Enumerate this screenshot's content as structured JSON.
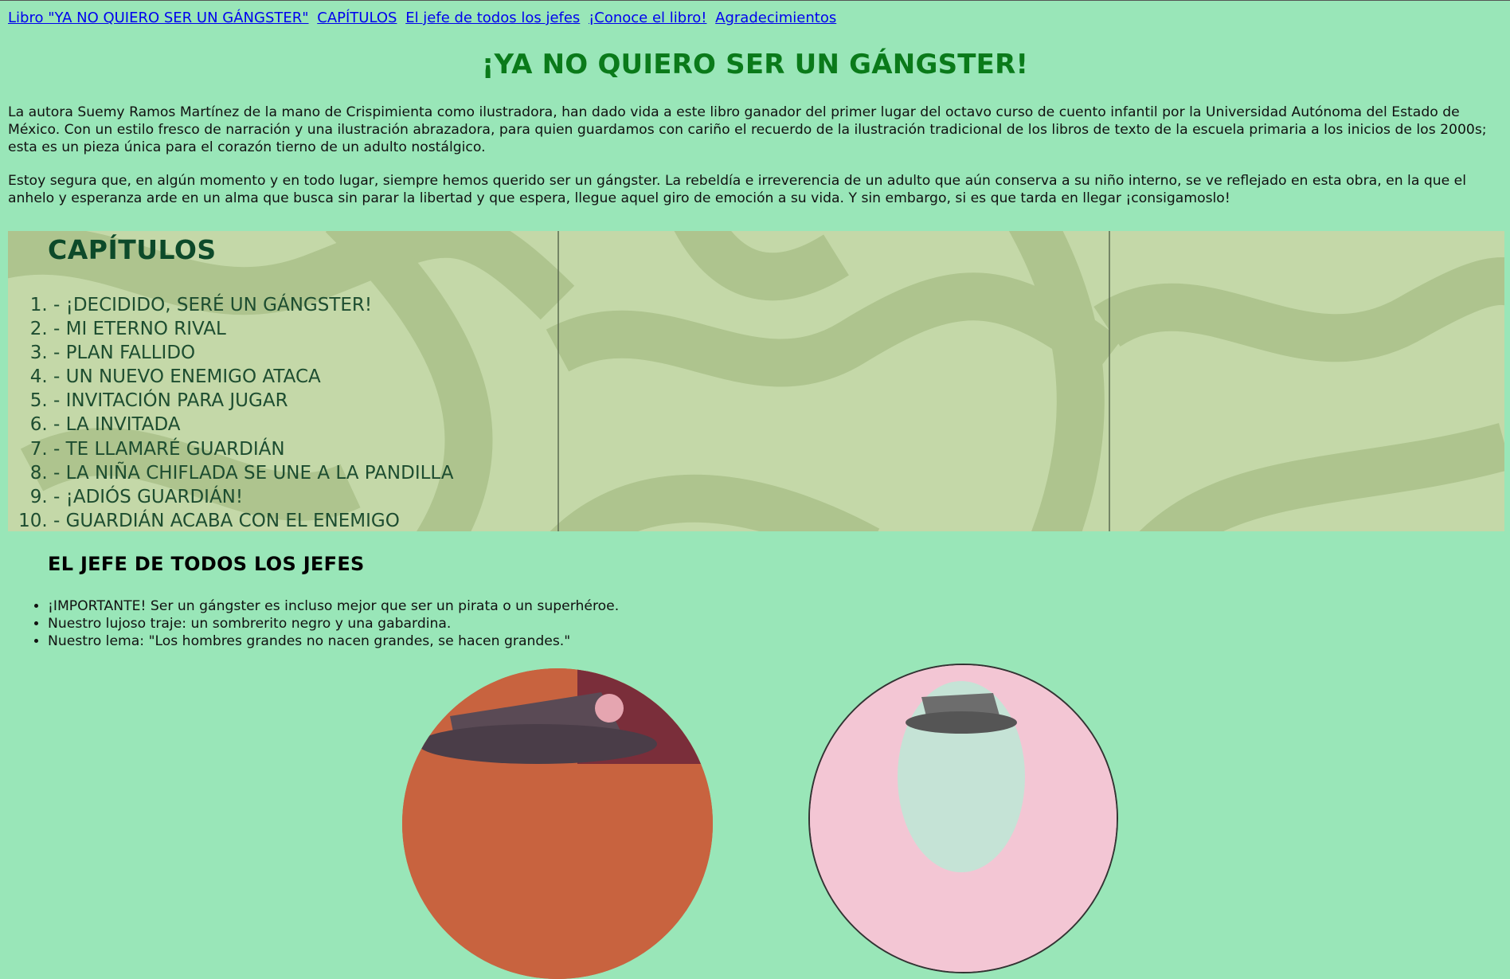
{
  "nav": {
    "links": [
      "Libro \"YA NO QUIERO SER UN GÁNGSTER\"",
      "CAPÍTULOS",
      "El jefe de todos los jefes",
      "¡Conoce el libro!",
      "Agradecimientos"
    ]
  },
  "header": {
    "title": "¡YA NO QUIERO SER UN GÁNGSTER!"
  },
  "intro": {
    "paragraph1": "La autora Suemy Ramos Martínez de la mano de Crispimienta como ilustradora, han dado vida a este libro ganador del primer lugar del octavo curso de cuento infantil por la Universidad Autónoma del Estado de México. Con un estilo fresco de narración y una ilustración abrazadora, para quien guardamos con cariño el recuerdo de la ilustración tradicional de los libros de texto de la escuela primaria a los inicios de los 2000s; esta es un pieza única para el corazón tierno de un adulto nostálgico.",
    "paragraph2": "Estoy segura que, en algún momento y en todo lugar, siempre hemos querido ser un gángster. La rebeldía e irreverencia de un adulto que aún conserva a su niño interno, se ve reflejado en esta obra, en la que el anhelo y esperanza arde en un alma que busca sin parar la libertad y que espera, llegue aquel giro de emoción a su vida. Y sin embargo, si es que tarda en llegar ¡consigamoslo!"
  },
  "chapters": {
    "title": "CAPÍTULOS",
    "items": [
      "- ¡DECIDIDO, SERÉ UN GÁNGSTER!",
      "- MI ETERNO RIVAL",
      "- PLAN FALLIDO",
      "- UN NUEVO ENEMIGO ATACA",
      "- INVITACIÓN PARA JUGAR",
      "- LA INVITADA",
      "- TE LLAMARÉ GUARDIÁN",
      "- LA NIÑA CHIFLADA SE UNE A LA PANDILLA",
      "- ¡ADIÓS GUARDIÁN!",
      "- GUARDIÁN ACABA CON EL ENEMIGO"
    ]
  },
  "jefe": {
    "title": "EL JEFE DE TODOS LOS JEFES",
    "items": [
      "¡IMPORTANTE! Ser un gángster es incluso mejor que ser un pirata o un superhéroe.",
      "Nuestro lujoso traje: un sombrerito negro y una gabardina.",
      "Nuestro lema: \"Los hombres grandes no nacen grandes, se hacen grandes.\""
    ]
  },
  "colors": {
    "page_background": "#99e6b8",
    "title_green": "#0a7a1a",
    "link_blue": "#0000ee",
    "chapters_background": "#c4d8a8",
    "chapters_text": "#1d4d30"
  }
}
